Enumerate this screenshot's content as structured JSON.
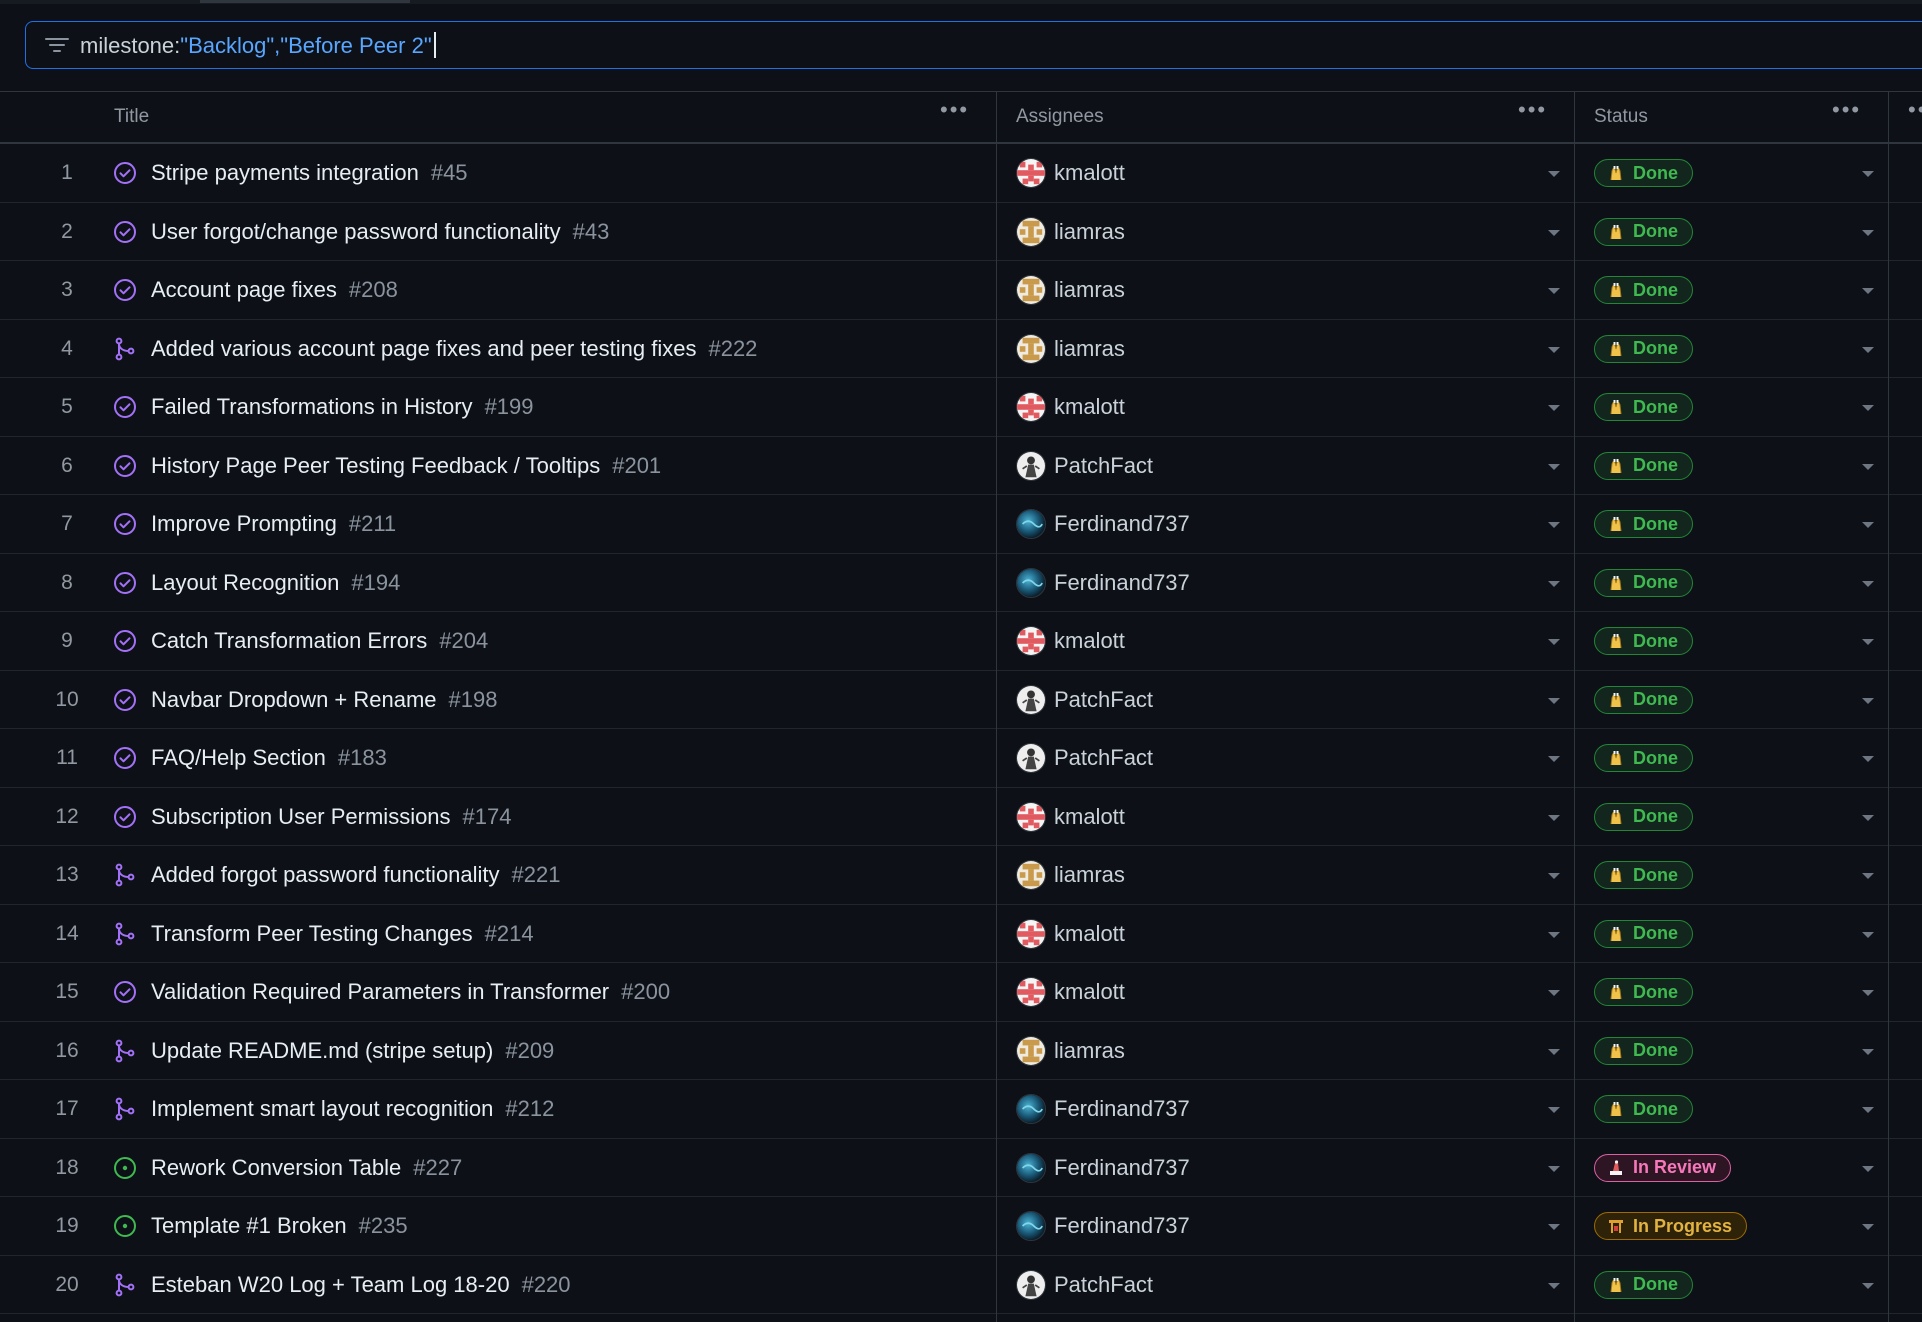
{
  "filter": {
    "prefix": "milestone:",
    "value": "\"Backlog\",\"Before Peer 2\""
  },
  "columns": {
    "title": "Title",
    "assignees": "Assignees",
    "status": "Status",
    "menu": "•••"
  },
  "colors": {
    "done": "#3fb950",
    "in_review": "#f778ba",
    "in_progress": "#e3b341",
    "closed_issue": "#a371f7",
    "open_issue": "#3fb950",
    "merged_pr": "#a371f7"
  },
  "rows": [
    {
      "num": "1",
      "type": "closed-issue",
      "title": "Stripe payments integration",
      "issue": "#45",
      "assignee": "kmalott",
      "avatar": "kmalott",
      "status": "Done"
    },
    {
      "num": "2",
      "type": "closed-issue",
      "title": "User forgot/change password functionality",
      "issue": "#43",
      "assignee": "liamras",
      "avatar": "liamras",
      "status": "Done"
    },
    {
      "num": "3",
      "type": "closed-issue",
      "title": "Account page fixes",
      "issue": "#208",
      "assignee": "liamras",
      "avatar": "liamras",
      "status": "Done"
    },
    {
      "num": "4",
      "type": "merged-pr",
      "title": "Added various account page fixes and peer testing fixes",
      "issue": "#222",
      "assignee": "liamras",
      "avatar": "liamras",
      "status": "Done"
    },
    {
      "num": "5",
      "type": "closed-issue",
      "title": "Failed Transformations in History",
      "issue": "#199",
      "assignee": "kmalott",
      "avatar": "kmalott",
      "status": "Done"
    },
    {
      "num": "6",
      "type": "closed-issue",
      "title": "History Page Peer Testing Feedback / Tooltips",
      "issue": "#201",
      "assignee": "PatchFact",
      "avatar": "PatchFact",
      "status": "Done"
    },
    {
      "num": "7",
      "type": "closed-issue",
      "title": "Improve Prompting",
      "issue": "#211",
      "assignee": "Ferdinand737",
      "avatar": "Ferdinand737",
      "status": "Done"
    },
    {
      "num": "8",
      "type": "closed-issue",
      "title": "Layout Recognition",
      "issue": "#194",
      "assignee": "Ferdinand737",
      "avatar": "Ferdinand737",
      "status": "Done"
    },
    {
      "num": "9",
      "type": "closed-issue",
      "title": "Catch Transformation Errors",
      "issue": "#204",
      "assignee": "kmalott",
      "avatar": "kmalott",
      "status": "Done"
    },
    {
      "num": "10",
      "type": "closed-issue",
      "title": "Navbar Dropdown + Rename",
      "issue": "#198",
      "assignee": "PatchFact",
      "avatar": "PatchFact",
      "status": "Done"
    },
    {
      "num": "11",
      "type": "closed-issue",
      "title": "FAQ/Help Section",
      "issue": "#183",
      "assignee": "PatchFact",
      "avatar": "PatchFact",
      "status": "Done"
    },
    {
      "num": "12",
      "type": "closed-issue",
      "title": "Subscription User Permissions",
      "issue": "#174",
      "assignee": "kmalott",
      "avatar": "kmalott",
      "status": "Done"
    },
    {
      "num": "13",
      "type": "merged-pr",
      "title": "Added forgot password functionality",
      "issue": "#221",
      "assignee": "liamras",
      "avatar": "liamras",
      "status": "Done"
    },
    {
      "num": "14",
      "type": "merged-pr",
      "title": "Transform Peer Testing Changes",
      "issue": "#214",
      "assignee": "kmalott",
      "avatar": "kmalott",
      "status": "Done"
    },
    {
      "num": "15",
      "type": "closed-issue",
      "title": "Validation Required Parameters in Transformer",
      "issue": "#200",
      "assignee": "kmalott",
      "avatar": "kmalott",
      "status": "Done"
    },
    {
      "num": "16",
      "type": "merged-pr",
      "title": "Update README.md (stripe setup)",
      "issue": "#209",
      "assignee": "liamras",
      "avatar": "liamras",
      "status": "Done"
    },
    {
      "num": "17",
      "type": "merged-pr",
      "title": "Implement smart layout recognition",
      "issue": "#212",
      "assignee": "Ferdinand737",
      "avatar": "Ferdinand737",
      "status": "Done"
    },
    {
      "num": "18",
      "type": "open-issue",
      "title": "Rework Conversion Table",
      "issue": "#227",
      "assignee": "Ferdinand737",
      "avatar": "Ferdinand737",
      "status": "In Review"
    },
    {
      "num": "19",
      "type": "open-issue",
      "title": "Template #1 Broken",
      "issue": "#235",
      "assignee": "Ferdinand737",
      "avatar": "Ferdinand737",
      "status": "In Progress"
    },
    {
      "num": "20",
      "type": "merged-pr",
      "title": "Esteban W20 Log + Team Log 18-20",
      "issue": "#220",
      "assignee": "PatchFact",
      "avatar": "PatchFact",
      "status": "Done"
    }
  ]
}
